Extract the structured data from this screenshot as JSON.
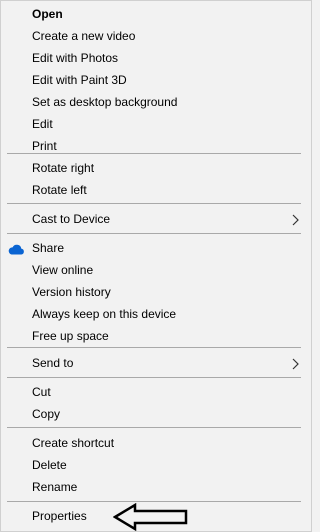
{
  "context_menu": {
    "items": [
      {
        "label": "Open"
      },
      {
        "label": "Create a new video"
      },
      {
        "label": "Edit with Photos"
      },
      {
        "label": "Edit with Paint 3D"
      },
      {
        "label": "Set as desktop background"
      },
      {
        "label": "Edit"
      },
      {
        "label": "Print"
      },
      {
        "label": "Rotate right"
      },
      {
        "label": "Rotate left"
      },
      {
        "label": "Cast to Device"
      },
      {
        "label": "Share"
      },
      {
        "label": "View online"
      },
      {
        "label": "Version history"
      },
      {
        "label": "Always keep on this device"
      },
      {
        "label": "Free up space"
      },
      {
        "label": "Send to"
      },
      {
        "label": "Cut"
      },
      {
        "label": "Copy"
      },
      {
        "label": "Create shortcut"
      },
      {
        "label": "Delete"
      },
      {
        "label": "Rename"
      },
      {
        "label": "Properties"
      }
    ],
    "icons": {
      "cloud": "cloud-icon",
      "submenu": "chevron-right-icon",
      "annotation": "arrow-left-annotation"
    },
    "colors": {
      "background": "#f2f2f2",
      "separator": "#a9a9a9",
      "cloud": "#0a64d2",
      "text": "#000000"
    }
  }
}
